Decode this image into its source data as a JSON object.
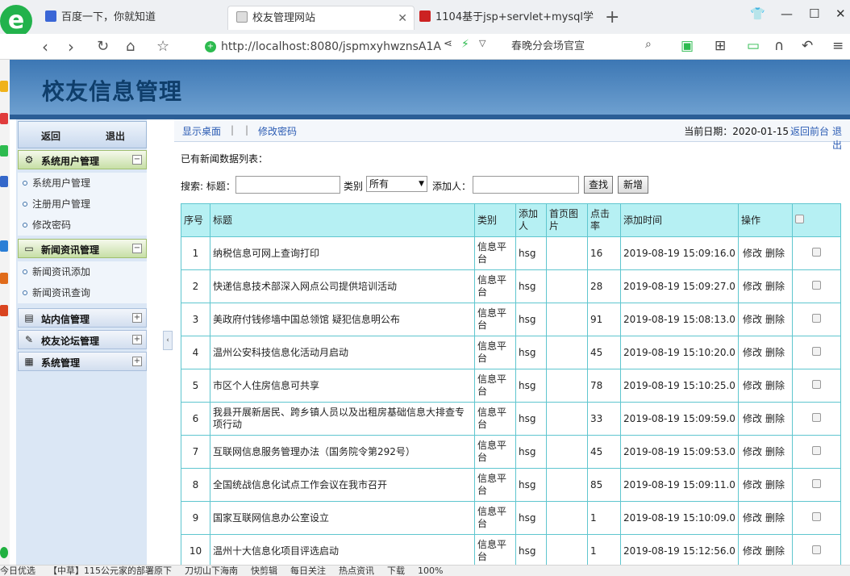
{
  "browser": {
    "tabs": [
      {
        "label": "百度一下，你就知道"
      },
      {
        "label": "校友管理网站"
      },
      {
        "label": "1104基于jsp+servlet+mysql学"
      }
    ],
    "url": "http://localhost:8080/jspmxyhwznsA1A",
    "url_right": "春晚分会场官宣",
    "colors": {
      "accent": "#22b24c",
      "tab_bar": "#eef0f3"
    }
  },
  "app": {
    "title": "校友信息管理",
    "sidebar": {
      "back_label": "返回",
      "logout_label": "退出",
      "sections": [
        {
          "label": "系统用户管理",
          "icon": "gear-icon",
          "expanded": true,
          "items": [
            "系统用户管理",
            "注册用户管理",
            "修改密码"
          ]
        },
        {
          "label": "新闻资讯管理",
          "icon": "monitor-icon",
          "expanded": true,
          "items": [
            "新闻资讯添加",
            "新闻资讯查询"
          ]
        },
        {
          "label": "站内信管理",
          "icon": "folder-icon",
          "expanded": false
        },
        {
          "label": "校友论坛管理",
          "icon": "forum-icon",
          "expanded": false
        },
        {
          "label": "系统管理",
          "icon": "chart-icon",
          "expanded": false
        }
      ]
    },
    "topbar": {
      "show_desktop": "显示桌面",
      "sep": "|",
      "change_password": "修改密码",
      "date_text": "当前日期：2020-01-15",
      "back_front": "返回前台",
      "logout": "退出"
    },
    "list_title": "已有新闻数据列表：",
    "search": {
      "search_label": "搜索: 标题：",
      "title_value": "",
      "category_label": "类别",
      "category_value": "所有",
      "adder_label": "添加人：",
      "adder_value": "",
      "search_button": "查找",
      "add_button": "新增"
    },
    "table": {
      "headers": [
        "序号",
        "标题",
        "类别",
        "添加人",
        "首页图片",
        "点击率",
        "添加时间",
        "操作"
      ],
      "edit_label": "修改",
      "delete_label": "删除",
      "rows": [
        {
          "no": "1",
          "title": "纳税信息可网上查询打印",
          "category": "信息平台",
          "adder": "hsg",
          "image": "",
          "clicks": "16",
          "time": "2019-08-19 15:09:16.0"
        },
        {
          "no": "2",
          "title": "快递信息技术部深入网点公司提供培训活动",
          "category": "信息平台",
          "adder": "hsg",
          "image": "",
          "clicks": "28",
          "time": "2019-08-19 15:09:27.0"
        },
        {
          "no": "3",
          "title": "美政府付钱修墙中国总领馆 疑犯信息明公布",
          "category": "信息平台",
          "adder": "hsg",
          "image": "",
          "clicks": "91",
          "time": "2019-08-19 15:08:13.0"
        },
        {
          "no": "4",
          "title": "温州公安科技信息化活动月启动",
          "category": "信息平台",
          "adder": "hsg",
          "image": "",
          "clicks": "45",
          "time": "2019-08-19 15:10:20.0"
        },
        {
          "no": "5",
          "title": "市区个人住房信息可共享",
          "category": "信息平台",
          "adder": "hsg",
          "image": "",
          "clicks": "78",
          "time": "2019-08-19 15:10:25.0"
        },
        {
          "no": "6",
          "title": "我县开展新居民、跨乡镇人员以及出租房基础信息大排查专项行动",
          "category": "信息平台",
          "adder": "hsg",
          "image": "",
          "clicks": "33",
          "time": "2019-08-19 15:09:59.0"
        },
        {
          "no": "7",
          "title": "互联网信息服务管理办法（国务院令第292号）",
          "category": "信息平台",
          "adder": "hsg",
          "image": "",
          "clicks": "45",
          "time": "2019-08-19 15:09:53.0"
        },
        {
          "no": "8",
          "title": "全国统战信息化试点工作会议在我市召开",
          "category": "信息平台",
          "adder": "hsg",
          "image": "",
          "clicks": "85",
          "time": "2019-08-19 15:09:11.0"
        },
        {
          "no": "9",
          "title": "国家互联网信息办公室设立",
          "category": "信息平台",
          "adder": "hsg",
          "image": "",
          "clicks": "1",
          "time": "2019-08-19 15:10:09.0"
        },
        {
          "no": "10",
          "title": "温州十大信息化项目评选启动",
          "category": "信息平台",
          "adder": "hsg",
          "image": "",
          "clicks": "1",
          "time": "2019-08-19 15:12:56.0"
        }
      ]
    }
  },
  "statusbar": {
    "items": [
      "今日优选",
      "【中草】115公元家的部署原下",
      "刀切山下海南",
      "快剪辑",
      "每日关注",
      "热点资讯",
      "下载",
      "100%"
    ]
  }
}
